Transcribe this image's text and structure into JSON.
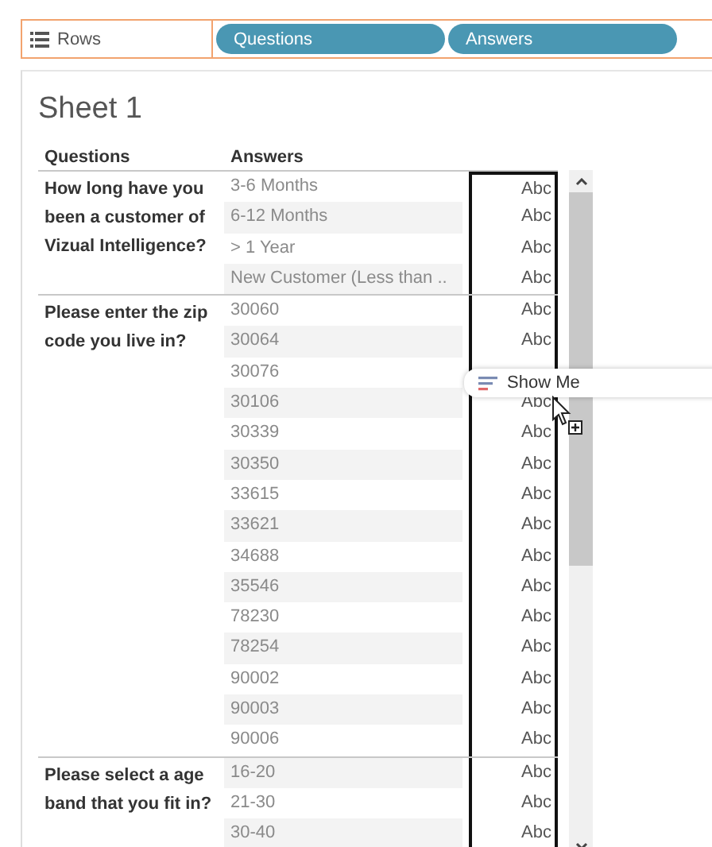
{
  "shelf": {
    "label": "Rows",
    "pills": [
      "Questions",
      "Answers"
    ]
  },
  "sheet": {
    "title": "Sheet 1",
    "columns": [
      "Questions",
      "Answers"
    ],
    "groups": [
      {
        "question": "How long have you been a customer of Vizual Intelligence?",
        "rows": [
          {
            "answer": "3-6 Months",
            "mark": "Abc"
          },
          {
            "answer": "6-12 Months",
            "mark": "Abc"
          },
          {
            "answer": "> 1 Year",
            "mark": "Abc"
          },
          {
            "answer": "New Customer (Less than ..",
            "mark": "Abc"
          }
        ]
      },
      {
        "question": "Please enter the zip code you live in?",
        "rows": [
          {
            "answer": "30060",
            "mark": "Abc"
          },
          {
            "answer": "30064",
            "mark": "Abc"
          },
          {
            "answer": "30076"
          },
          {
            "answer": "30106",
            "mark": "Abc"
          },
          {
            "answer": "30339",
            "mark": "Abc"
          },
          {
            "answer": "30350",
            "mark": "Abc"
          },
          {
            "answer": "33615",
            "mark": "Abc"
          },
          {
            "answer": "33621",
            "mark": "Abc"
          },
          {
            "answer": "34688",
            "mark": "Abc"
          },
          {
            "answer": "35546",
            "mark": "Abc"
          },
          {
            "answer": "78230",
            "mark": "Abc"
          },
          {
            "answer": "78254",
            "mark": "Abc"
          },
          {
            "answer": "90002",
            "mark": "Abc"
          },
          {
            "answer": "90003",
            "mark": "Abc"
          },
          {
            "answer": "90006",
            "mark": "Abc"
          }
        ]
      },
      {
        "question": "Please select a age band that you fit in?",
        "rows": [
          {
            "answer": "16-20",
            "mark": "Abc"
          },
          {
            "answer": "21-30",
            "mark": "Abc"
          },
          {
            "answer": "30-40",
            "mark": "Abc"
          }
        ]
      }
    ]
  },
  "tooltip": {
    "label": "Show Me"
  }
}
